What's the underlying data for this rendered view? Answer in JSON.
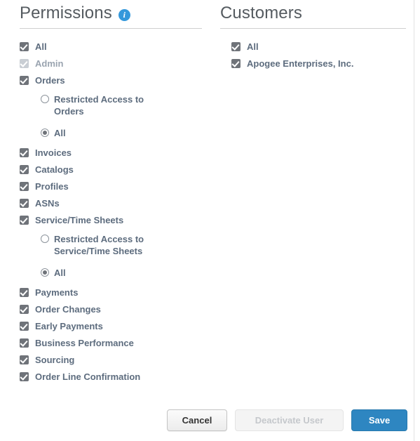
{
  "permissions": {
    "title": "Permissions",
    "info_icon": "info-icon",
    "info_glyph": "i",
    "items": [
      {
        "label": "All",
        "checked": true,
        "disabled": false
      },
      {
        "label": "Admin",
        "checked": true,
        "disabled": true
      },
      {
        "label": "Orders",
        "checked": true,
        "disabled": false
      },
      {
        "label": "Invoices",
        "checked": true,
        "disabled": false
      },
      {
        "label": "Catalogs",
        "checked": true,
        "disabled": false
      },
      {
        "label": "Profiles",
        "checked": true,
        "disabled": false
      },
      {
        "label": "ASNs",
        "checked": true,
        "disabled": false
      },
      {
        "label": "Service/Time Sheets",
        "checked": true,
        "disabled": false
      },
      {
        "label": "Payments",
        "checked": true,
        "disabled": false
      },
      {
        "label": "Order Changes",
        "checked": true,
        "disabled": false
      },
      {
        "label": "Early Payments",
        "checked": true,
        "disabled": false
      },
      {
        "label": "Business Performance",
        "checked": true,
        "disabled": false
      },
      {
        "label": "Sourcing",
        "checked": true,
        "disabled": false
      },
      {
        "label": "Order Line Confirmation",
        "checked": true,
        "disabled": false
      }
    ],
    "orders_radios": [
      {
        "label": "Restricted Access to Orders",
        "selected": false
      },
      {
        "label": "All",
        "selected": true
      }
    ],
    "service_time_sheets_radios": [
      {
        "label": "Restricted Access to Service/Time Sheets",
        "selected": false
      },
      {
        "label": "All",
        "selected": true
      }
    ]
  },
  "customers": {
    "title": "Customers",
    "items": [
      {
        "label": "All",
        "checked": true,
        "disabled": false
      },
      {
        "label": "Apogee Enterprises, Inc.",
        "checked": true,
        "disabled": false
      }
    ]
  },
  "footer": {
    "cancel_label": "Cancel",
    "deactivate_label": "Deactivate User",
    "save_label": "Save"
  },
  "colors": {
    "accent": "#2e86c1",
    "info_icon": "#3498db",
    "label_text": "#5d6c7e",
    "label_text_disabled": "#9aa4b0",
    "checkbox": "#6f7379",
    "checkbox_disabled": "#c9ced4",
    "heading": "#555b60",
    "rule": "#d0d0d0"
  }
}
